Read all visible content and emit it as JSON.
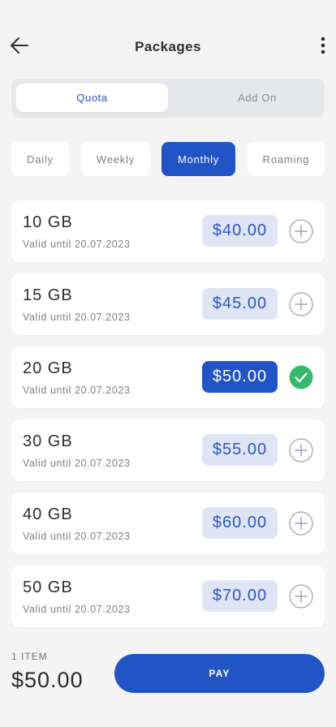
{
  "header": {
    "title": "Packages",
    "back_icon": "arrow-left-icon",
    "menu_icon": "more-vertical-icon"
  },
  "segments": {
    "active": "Quota",
    "inactive": "Add On"
  },
  "periods": [
    "Daily",
    "Weekly",
    "Monthly",
    "Roaming"
  ],
  "selected_period": "Monthly",
  "packages": [
    {
      "size": "10 GB",
      "validity": "Valid until 20.07.2023",
      "price": "$40.00",
      "selected": false
    },
    {
      "size": "15 GB",
      "validity": "Valid until 20.07.2023",
      "price": "$45.00",
      "selected": false
    },
    {
      "size": "20 GB",
      "validity": "Valid until 20.07.2023",
      "price": "$50.00",
      "selected": true
    },
    {
      "size": "30 GB",
      "validity": "Valid until 20.07.2023",
      "price": "$55.00",
      "selected": false
    },
    {
      "size": "40 GB",
      "validity": "Valid until 20.07.2023",
      "price": "$60.00",
      "selected": false
    },
    {
      "size": "50 GB",
      "validity": "Valid until 20.07.2023",
      "price": "$70.00",
      "selected": false
    }
  ],
  "footer": {
    "item_count": "1 ITEM",
    "total": "$50.00",
    "pay_label": "PAY"
  },
  "colors": {
    "primary": "#2154c4",
    "price_pill_bg": "#dfe5f5",
    "price_pill_text": "#2a58c0",
    "success": "#36b96d",
    "background": "#f4f4f5"
  }
}
